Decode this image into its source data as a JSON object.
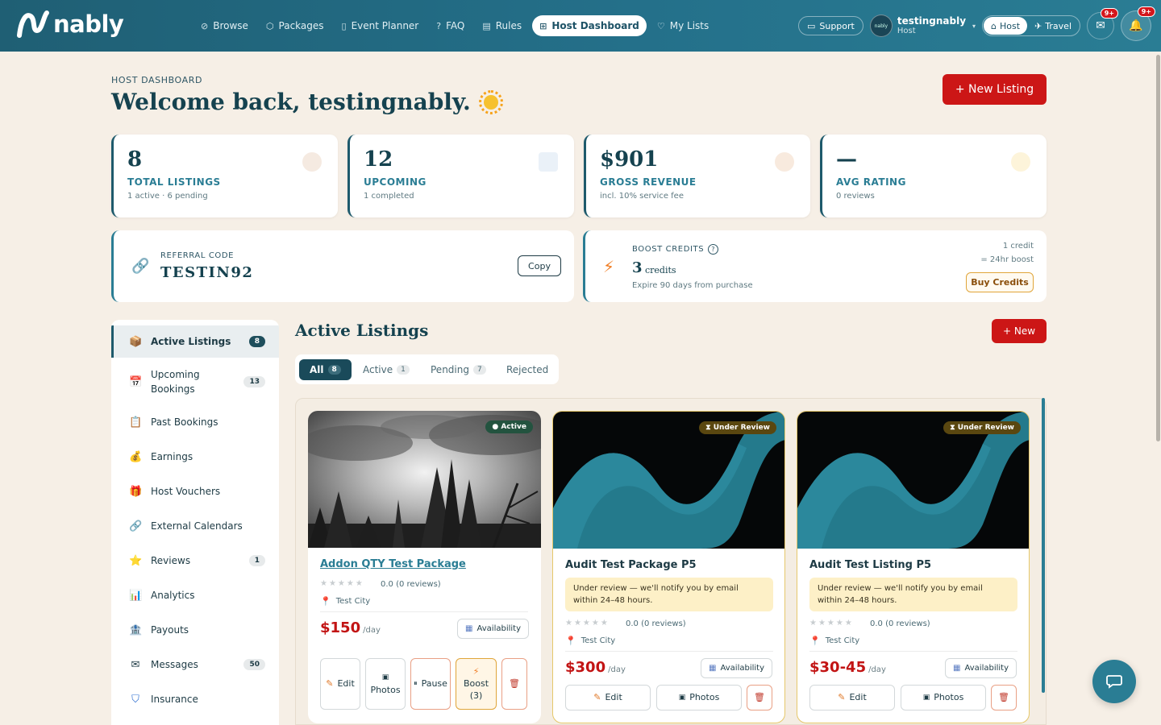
{
  "brand": {
    "name": "nably"
  },
  "nav": {
    "links": [
      {
        "label": "Browse",
        "icon": "compass-icon"
      },
      {
        "label": "Packages",
        "icon": "package-icon"
      },
      {
        "label": "Event Planner",
        "icon": "map-icon"
      },
      {
        "label": "FAQ",
        "icon": "help-icon"
      },
      {
        "label": "Rules",
        "icon": "clipboard-icon"
      },
      {
        "label": "Host Dashboard",
        "icon": "grid-icon"
      },
      {
        "label": "My Lists",
        "icon": "heart-icon"
      }
    ],
    "support": "Support",
    "user": {
      "name": "testingnably",
      "role": "Host",
      "avatar_text": "nably"
    },
    "mode": {
      "host": "Host",
      "travel": "Travel"
    },
    "messages_badge": "9+",
    "notifications_badge": "9+"
  },
  "header": {
    "eyebrow": "HOST DASHBOARD",
    "welcome": "Welcome back, testingnably.",
    "new_listing": "+ New Listing"
  },
  "stats": [
    {
      "value": "8",
      "label": "TOTAL LISTINGS",
      "sub": "1 active · 6 pending"
    },
    {
      "value": "12",
      "label": "UPCOMING",
      "sub": "1 completed"
    },
    {
      "value": "$901",
      "label": "GROSS REVENUE",
      "sub": "incl. 10% service fee"
    },
    {
      "value": "—",
      "label": "AVG RATING",
      "sub": "0 reviews"
    }
  ],
  "referral": {
    "label": "REFERRAL CODE",
    "code": "TESTIN92",
    "copy": "Copy"
  },
  "boost": {
    "label": "BOOST CREDITS",
    "help": "?",
    "credits": "3",
    "unit": "credits",
    "sub": "Expire 90 days from purchase",
    "rate_line1": "1 credit",
    "rate_line2": "= 24hr boost",
    "buy": "Buy Credits"
  },
  "sidebar": {
    "items": [
      {
        "label": "Active Listings",
        "count": "8",
        "icon": "box-icon"
      },
      {
        "label": "Upcoming Bookings",
        "count": "13",
        "icon": "calendar-icon"
      },
      {
        "label": "Past Bookings",
        "count": "",
        "icon": "clipboard-icon"
      },
      {
        "label": "Earnings",
        "count": "",
        "icon": "money-bag-icon"
      },
      {
        "label": "Host Vouchers",
        "count": "",
        "icon": "gift-icon"
      },
      {
        "label": "External Calendars",
        "count": "",
        "icon": "link-icon"
      },
      {
        "label": "Reviews",
        "count": "1",
        "icon": "star-icon"
      },
      {
        "label": "Analytics",
        "count": "",
        "icon": "bar-chart-icon"
      },
      {
        "label": "Payouts",
        "count": "",
        "icon": "bank-icon"
      },
      {
        "label": "Messages",
        "count": "50",
        "icon": "envelope-icon"
      },
      {
        "label": "Insurance",
        "count": "",
        "icon": "shield-icon"
      }
    ]
  },
  "listings_section": {
    "title": "Active Listings",
    "new": "+ New",
    "tabs": [
      {
        "label": "All",
        "count": "8"
      },
      {
        "label": "Active",
        "count": "1"
      },
      {
        "label": "Pending",
        "count": "7"
      },
      {
        "label": "Rejected",
        "count": ""
      }
    ]
  },
  "cards": [
    {
      "status": "● Active",
      "title": "Addon QTY Test Package",
      "rating": "0.0 (0 reviews)",
      "city": "Test City",
      "price": "$150",
      "per": "/day",
      "availability": "Availability",
      "actions": {
        "edit": "Edit",
        "photos": "Photos",
        "pause": "Pause",
        "boost": "Boost",
        "boost_count": "(3)"
      }
    },
    {
      "status": "⧗ Under Review",
      "title": "Audit Test Package P5",
      "note": "Under review — we'll notify you by email within 24–48 hours.",
      "rating": "0.0 (0 reviews)",
      "city": "Test City",
      "price": "$300",
      "per": "/day",
      "availability": "Availability",
      "actions": {
        "edit": "Edit",
        "photos": "Photos"
      }
    },
    {
      "status": "⧗ Under Review",
      "title": "Audit Test Listing P5",
      "note": "Under review — we'll notify you by email within 24–48 hours.",
      "rating": "0.0 (0 reviews)",
      "city": "Test City",
      "price": "$30-45",
      "per": "/day",
      "availability": "Availability",
      "actions": {
        "edit": "Edit",
        "photos": "Photos"
      }
    }
  ],
  "colors": {
    "nav": "#24708a",
    "accent_red": "#cc1616",
    "teal": "#2a7d94",
    "bg": "#f6efe6"
  }
}
